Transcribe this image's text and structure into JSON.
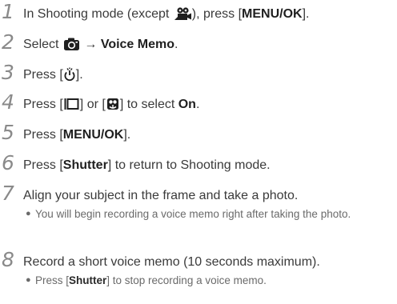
{
  "steps": [
    {
      "num": "1",
      "t1": "In Shooting mode (except ",
      "icon": "movie-mode-icon",
      "t2": "), press [",
      "bold": "MENU/OK",
      "t3": "]."
    },
    {
      "num": "2",
      "t1": "Select ",
      "icon": "camera-icon",
      "arrow": "→",
      "bold": "Voice Memo",
      "t3": "."
    },
    {
      "num": "3",
      "t1": "Press [",
      "icon": "timer-icon",
      "t3": "]."
    },
    {
      "num": "4",
      "t1": "Press [",
      "icon1": "display-icon",
      "mid": "] or [",
      "icon2": "macro-flower-icon",
      "t2": "] to select ",
      "bold": "On",
      "t3": "."
    },
    {
      "num": "5",
      "t1": "Press [",
      "bold": "MENU/OK",
      "t3": "]."
    },
    {
      "num": "6",
      "t1": "Press [",
      "bold": "Shutter",
      "t3": "] to return to Shooting mode."
    },
    {
      "num": "7",
      "text": "Align your subject in the frame and take a photo.",
      "bullet": "You will begin recording a voice memo right after taking the photo."
    },
    {
      "num": "8",
      "text": "Record a short voice memo (10 seconds maximum).",
      "b_pre": "Press [",
      "b_bold": "Shutter",
      "b_post": "] to stop recording a voice memo."
    }
  ]
}
